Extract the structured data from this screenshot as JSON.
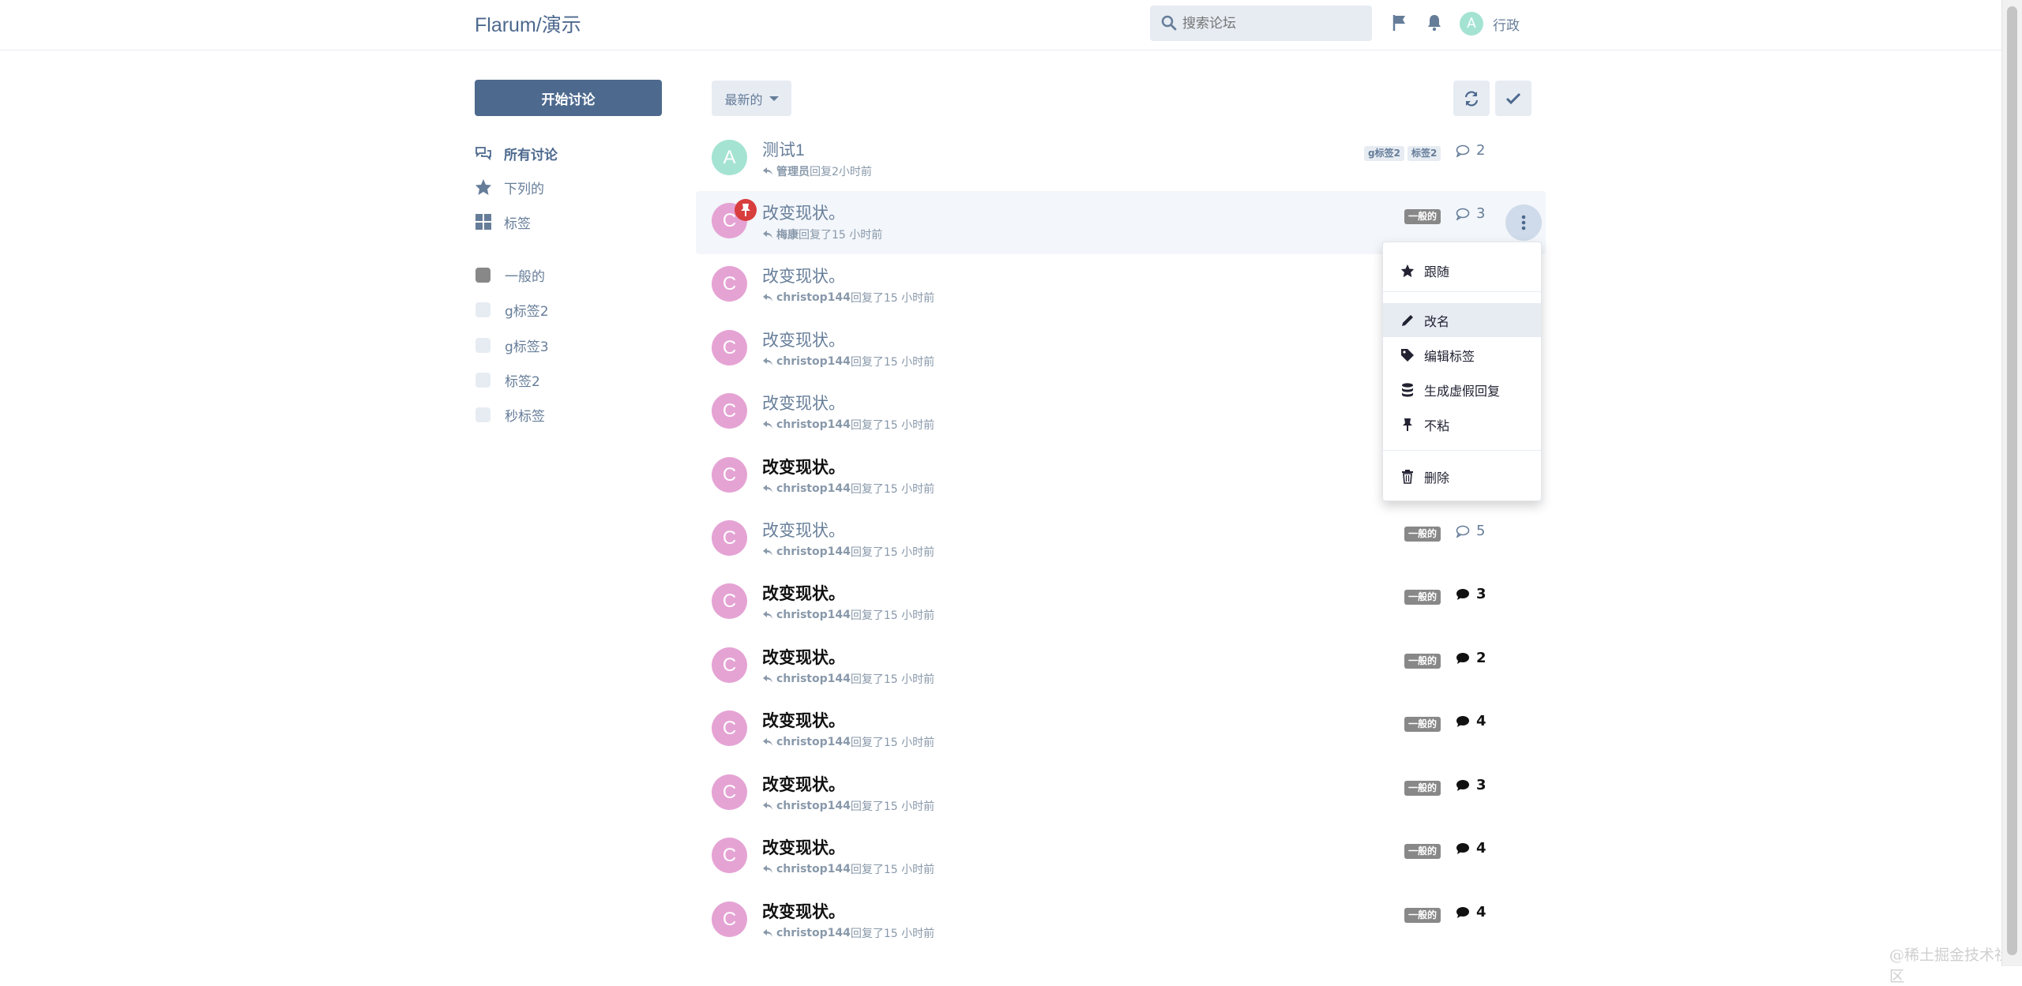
{
  "header": {
    "brand": "Flarum/演示",
    "search_placeholder": "搜索论坛",
    "user_initial": "A",
    "user_name": "行政"
  },
  "sidebar": {
    "start_label": "开始讨论",
    "nav": [
      {
        "label": "所有讨论",
        "icon": "comments-icon",
        "active": true
      },
      {
        "label": "下列的",
        "icon": "star-icon"
      },
      {
        "label": "标签",
        "icon": "grid-icon"
      }
    ],
    "tags": [
      {
        "label": "一般的",
        "color": "#888888"
      },
      {
        "label": "g标签2",
        "color": "#e7ecf3"
      },
      {
        "label": "g标签3",
        "color": "#e7ecf3"
      },
      {
        "label": "标签2",
        "color": "#e7ecf3"
      },
      {
        "label": "秒标签",
        "color": "#e7ecf3"
      }
    ]
  },
  "toolbar": {
    "sort_label": "最新的"
  },
  "discussions": [
    {
      "initial": "A",
      "avatar_color": "#a4e3d2",
      "title": "测试1",
      "user": "管理员",
      "action": "回复",
      "time": "2小时前",
      "tags": [
        "g标签2",
        "标签2"
      ],
      "tag_style": "light",
      "count": "2",
      "unread": false
    },
    {
      "initial": "C",
      "avatar_color": "#e5a3d4",
      "title": "改变现状。",
      "user": "梅康",
      "action": "回复了",
      "time": "15 小时前",
      "tags": [
        "一般的"
      ],
      "tag_style": "general",
      "count": "3",
      "unread": false,
      "pinned": true
    },
    {
      "initial": "C",
      "avatar_color": "#e5a3d4",
      "title": "改变现状。",
      "user": "christop144",
      "action": "回复了",
      "time": "15 小时前",
      "unread": false
    },
    {
      "initial": "C",
      "avatar_color": "#e5a3d4",
      "title": "改变现状。",
      "user": "christop144",
      "action": "回复了",
      "time": "15 小时前",
      "unread": false
    },
    {
      "initial": "C",
      "avatar_color": "#e5a3d4",
      "title": "改变现状。",
      "user": "christop144",
      "action": "回复了",
      "time": "15 小时前",
      "unread": false
    },
    {
      "initial": "C",
      "avatar_color": "#e5a3d4",
      "title": "改变现状。",
      "user": "christop144",
      "action": "回复了",
      "time": "15 小时前",
      "unread": true
    },
    {
      "initial": "C",
      "avatar_color": "#e5a3d4",
      "title": "改变现状。",
      "user": "christop144",
      "action": "回复了",
      "time": "15 小时前",
      "tags": [
        "一般的"
      ],
      "tag_style": "general",
      "count": "5",
      "unread": false
    },
    {
      "initial": "C",
      "avatar_color": "#e5a3d4",
      "title": "改变现状。",
      "user": "christop144",
      "action": "回复了",
      "time": "15 小时前",
      "tags": [
        "一般的"
      ],
      "tag_style": "general",
      "count": "3",
      "unread": true
    },
    {
      "initial": "C",
      "avatar_color": "#e5a3d4",
      "title": "改变现状。",
      "user": "christop144",
      "action": "回复了",
      "time": "15 小时前",
      "tags": [
        "一般的"
      ],
      "tag_style": "general",
      "count": "2",
      "unread": true
    },
    {
      "initial": "C",
      "avatar_color": "#e5a3d4",
      "title": "改变现状。",
      "user": "christop144",
      "action": "回复了",
      "time": "15 小时前",
      "tags": [
        "一般的"
      ],
      "tag_style": "general",
      "count": "4",
      "unread": true
    },
    {
      "initial": "C",
      "avatar_color": "#e5a3d4",
      "title": "改变现状。",
      "user": "christop144",
      "action": "回复了",
      "time": "15 小时前",
      "tags": [
        "一般的"
      ],
      "tag_style": "general",
      "count": "3",
      "unread": true
    },
    {
      "initial": "C",
      "avatar_color": "#e5a3d4",
      "title": "改变现状。",
      "user": "christop144",
      "action": "回复了",
      "time": "15 小时前",
      "tags": [
        "一般的"
      ],
      "tag_style": "general",
      "count": "4",
      "unread": true
    },
    {
      "initial": "C",
      "avatar_color": "#e5a3d4",
      "title": "改变现状。",
      "user": "christop144",
      "action": "回复了",
      "time": "15 小时前",
      "tags": [
        "一般的"
      ],
      "tag_style": "general",
      "count": "4",
      "unread": true
    }
  ],
  "dropdown": {
    "follow": "跟随",
    "rename": "改名",
    "edit_tags": "编辑标签",
    "fake_replies": "生成虚假回复",
    "unsticky": "不粘",
    "delete": "删除"
  },
  "watermark": "@稀土掘金技术社区"
}
